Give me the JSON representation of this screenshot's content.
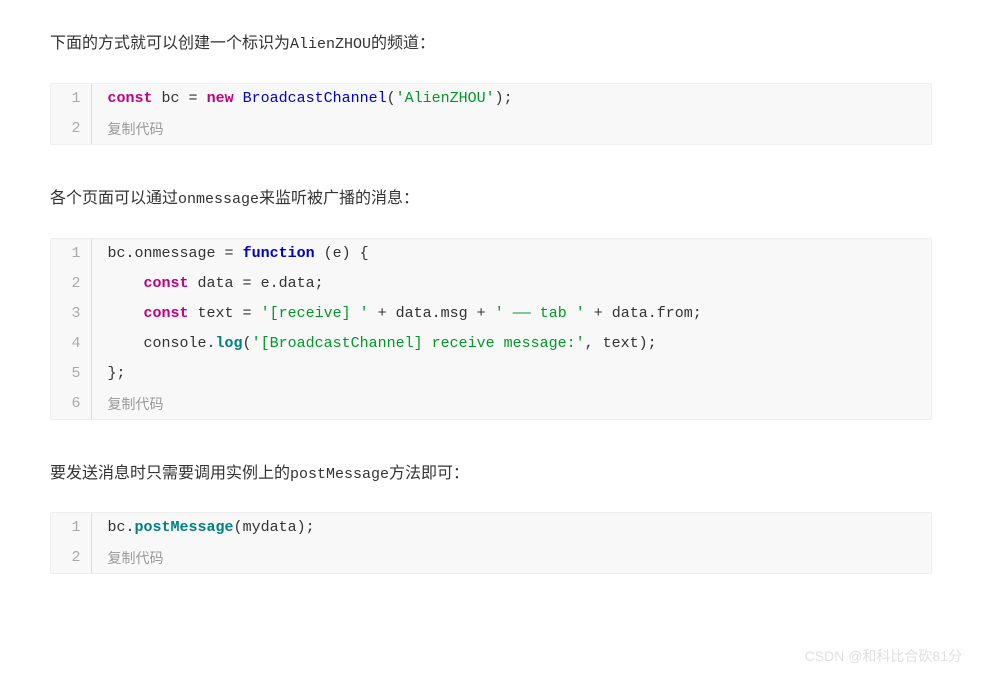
{
  "para1": {
    "pre": "下面的方式就可以创建一个标识为",
    "code": "AlienZHOU",
    "post": "的频道："
  },
  "code1": {
    "lines": [
      {
        "num": "1",
        "segments": [
          {
            "cls": "tok-keyword",
            "text": "const"
          },
          {
            "cls": "tok-ident",
            "text": " bc "
          },
          {
            "cls": "tok-operator",
            "text": "="
          },
          {
            "cls": "tok-ident",
            "text": " "
          },
          {
            "cls": "tok-keyword",
            "text": "new"
          },
          {
            "cls": "tok-ident",
            "text": " "
          },
          {
            "cls": "tok-classname",
            "text": "BroadcastChannel"
          },
          {
            "cls": "tok-punct",
            "text": "("
          },
          {
            "cls": "tok-string",
            "text": "'AlienZHOU'"
          },
          {
            "cls": "tok-punct",
            "text": ");"
          }
        ]
      }
    ],
    "copy_num": "2",
    "copy_label": "复制代码"
  },
  "para2": {
    "pre": "各个页面可以通过",
    "code": "onmessage",
    "post": "来监听被广播的消息："
  },
  "code2": {
    "lines": [
      {
        "num": "1",
        "segments": [
          {
            "cls": "tok-ident",
            "text": "bc.onmessage "
          },
          {
            "cls": "tok-operator",
            "text": "="
          },
          {
            "cls": "tok-ident",
            "text": " "
          },
          {
            "cls": "tok-keyword2",
            "text": "function"
          },
          {
            "cls": "tok-ident",
            "text": " "
          },
          {
            "cls": "tok-punct",
            "text": "("
          },
          {
            "cls": "tok-ident",
            "text": "e"
          },
          {
            "cls": "tok-punct",
            "text": ")"
          },
          {
            "cls": "tok-ident",
            "text": " "
          },
          {
            "cls": "tok-punct",
            "text": "{"
          }
        ]
      },
      {
        "num": "2",
        "segments": [
          {
            "cls": "tok-ident",
            "text": "    "
          },
          {
            "cls": "tok-keyword",
            "text": "const"
          },
          {
            "cls": "tok-ident",
            "text": " data "
          },
          {
            "cls": "tok-operator",
            "text": "="
          },
          {
            "cls": "tok-ident",
            "text": " e.data;"
          }
        ]
      },
      {
        "num": "3",
        "segments": [
          {
            "cls": "tok-ident",
            "text": "    "
          },
          {
            "cls": "tok-keyword",
            "text": "const"
          },
          {
            "cls": "tok-ident",
            "text": " text "
          },
          {
            "cls": "tok-operator",
            "text": "="
          },
          {
            "cls": "tok-ident",
            "text": " "
          },
          {
            "cls": "tok-string",
            "text": "'[receive] '"
          },
          {
            "cls": "tok-ident",
            "text": " "
          },
          {
            "cls": "tok-operator",
            "text": "+"
          },
          {
            "cls": "tok-ident",
            "text": " data.msg "
          },
          {
            "cls": "tok-operator",
            "text": "+"
          },
          {
            "cls": "tok-ident",
            "text": " "
          },
          {
            "cls": "tok-string",
            "text": "' —— tab '"
          },
          {
            "cls": "tok-ident",
            "text": " "
          },
          {
            "cls": "tok-operator",
            "text": "+"
          },
          {
            "cls": "tok-ident",
            "text": " data.from;"
          }
        ]
      },
      {
        "num": "4",
        "segments": [
          {
            "cls": "tok-ident",
            "text": "    console."
          },
          {
            "cls": "tok-funcname",
            "text": "log"
          },
          {
            "cls": "tok-punct",
            "text": "("
          },
          {
            "cls": "tok-string",
            "text": "'[BroadcastChannel] receive message:'"
          },
          {
            "cls": "tok-punct",
            "text": ","
          },
          {
            "cls": "tok-ident",
            "text": " text"
          },
          {
            "cls": "tok-punct",
            "text": ");"
          }
        ]
      },
      {
        "num": "5",
        "segments": [
          {
            "cls": "tok-punct",
            "text": "};"
          }
        ]
      }
    ],
    "copy_num": "6",
    "copy_label": "复制代码"
  },
  "para3": {
    "pre": "要发送消息时只需要调用实例上的",
    "code": "postMessage",
    "post": "方法即可："
  },
  "code3": {
    "lines": [
      {
        "num": "1",
        "segments": [
          {
            "cls": "tok-ident",
            "text": "bc."
          },
          {
            "cls": "tok-funcname",
            "text": "postMessage"
          },
          {
            "cls": "tok-punct",
            "text": "("
          },
          {
            "cls": "tok-ident",
            "text": "mydata"
          },
          {
            "cls": "tok-punct",
            "text": ");"
          }
        ]
      }
    ],
    "copy_num": "2",
    "copy_label": "复制代码"
  },
  "watermark": "CSDN @和科比合砍81分"
}
